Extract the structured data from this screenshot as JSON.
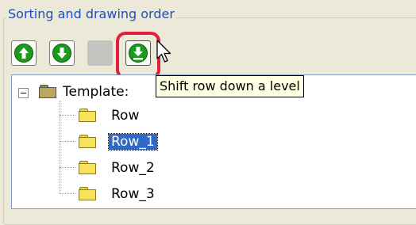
{
  "group": {
    "title": "Sorting and drawing order"
  },
  "toolbar": {
    "buttons": [
      {
        "icon": "arrow-up-icon",
        "state": "enabled"
      },
      {
        "icon": "arrow-down-icon",
        "state": "enabled"
      },
      {
        "icon": "blank",
        "state": "disabled"
      },
      {
        "icon": "shift-down-level-icon",
        "state": "hovered"
      }
    ]
  },
  "tree": {
    "root": {
      "label": "Template:",
      "expanded": true
    },
    "items": [
      {
        "label": "Row",
        "selected": false
      },
      {
        "label": "Row_1",
        "selected": true
      },
      {
        "label": "Row_2",
        "selected": false
      },
      {
        "label": "Row_3",
        "selected": false
      }
    ]
  },
  "tooltip": {
    "text": "Shift row down a level"
  },
  "colors": {
    "window_bg": "#ece9d8",
    "group_title": "#1f4ec0",
    "button_green": "#1b9a1b",
    "highlight_ring": "#e3203c",
    "selection": "#316ac5",
    "tooltip_bg": "#ffffe1",
    "folder": "#f7e25b"
  }
}
